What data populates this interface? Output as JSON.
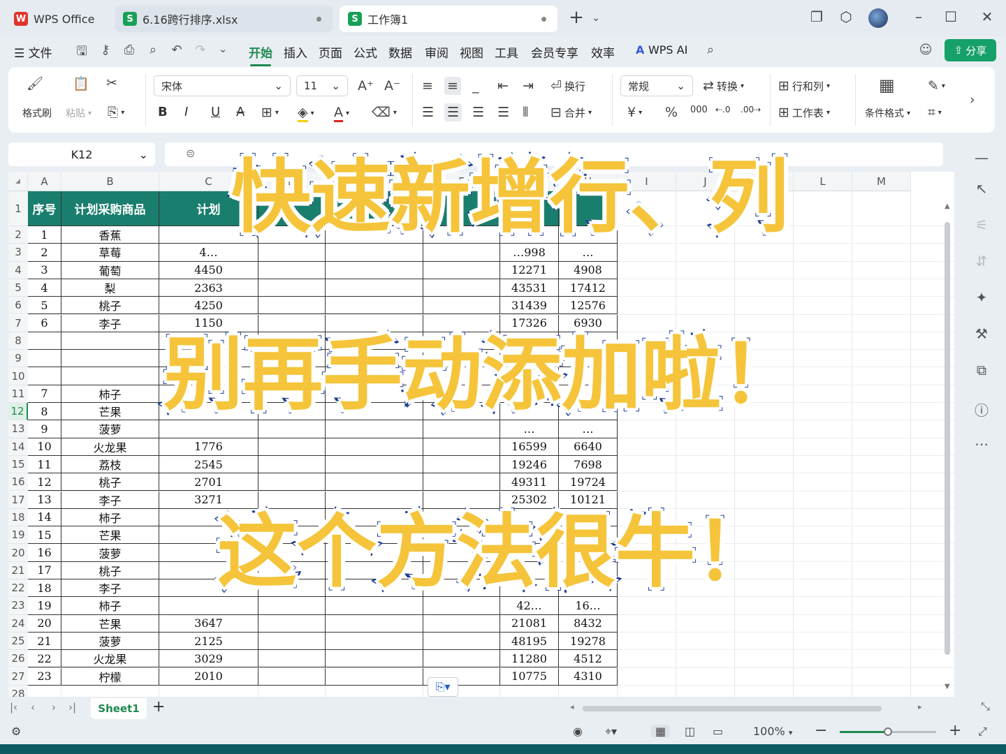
{
  "titlebar": {
    "tabs": [
      {
        "label": "WPS Office",
        "icon": "wps-logo-icon"
      },
      {
        "label": "6.16跨行排序.xlsx",
        "icon": "sheet-s-icon"
      },
      {
        "label": "工作簿1",
        "icon": "sheet-s-icon"
      }
    ],
    "new_tab": "+"
  },
  "menubar": {
    "file": "文件",
    "items": [
      "开始",
      "插入",
      "页面",
      "公式",
      "数据",
      "审阅",
      "视图",
      "工具",
      "会员专享",
      "效率"
    ],
    "wps_ai": "WPS AI",
    "share": "分享"
  },
  "ribbon": {
    "format_painter": "格式刷",
    "paste": "粘贴",
    "font_name": "宋体",
    "font_size": "11",
    "wrap": "换行",
    "merge": "合并",
    "number_format": "常规",
    "convert": "转换",
    "rows_cols": "行和列",
    "worksheet": "工作表",
    "cond_format": "条件格式",
    "bold": "B",
    "italic": "I",
    "underline": "U",
    "strike": "A",
    "currency": "¥",
    "percent": "%"
  },
  "formula": {
    "namebox": "K12"
  },
  "sheet": {
    "columns": [
      "A",
      "B",
      "C",
      "D",
      "E",
      "F",
      "G",
      "H",
      "I",
      "J",
      "K",
      "L",
      "M"
    ],
    "header": [
      "序号",
      "计划采购商品",
      "计划"
    ],
    "rows": [
      {
        "r": "1"
      },
      {
        "r": "2",
        "a": "1",
        "b": "香蕉",
        "c": "",
        "g": "",
        "h": ""
      },
      {
        "r": "3",
        "a": "2",
        "b": "草莓",
        "c": "4…",
        "g": "…998",
        "h": "…"
      },
      {
        "r": "4",
        "a": "3",
        "b": "葡萄",
        "c": "4450",
        "g": "12271",
        "h": "4908"
      },
      {
        "r": "5",
        "a": "4",
        "b": "梨",
        "c": "2363",
        "g": "43531",
        "h": "17412"
      },
      {
        "r": "6",
        "a": "5",
        "b": "桃子",
        "c": "4250",
        "g": "31439",
        "h": "12576"
      },
      {
        "r": "7",
        "a": "6",
        "b": "李子",
        "c": "1150",
        "g": "17326",
        "h": "6930"
      },
      {
        "r": "8",
        "a": "",
        "b": "",
        "c": "",
        "g": "",
        "h": ""
      },
      {
        "r": "9",
        "a": "",
        "b": "",
        "c": "",
        "g": "",
        "h": ""
      },
      {
        "r": "10",
        "a": "",
        "b": "",
        "c": "",
        "g": "",
        "h": ""
      },
      {
        "r": "11",
        "a": "7",
        "b": "柿子",
        "c": "",
        "g": "",
        "h": ""
      },
      {
        "r": "12",
        "a": "8",
        "b": "芒果",
        "c": "",
        "g": "",
        "h": ""
      },
      {
        "r": "13",
        "a": "9",
        "b": "菠萝",
        "c": "",
        "g": "…",
        "h": "…"
      },
      {
        "r": "14",
        "a": "10",
        "b": "火龙果",
        "c": "1776",
        "g": "16599",
        "h": "6640"
      },
      {
        "r": "15",
        "a": "11",
        "b": "荔枝",
        "c": "2545",
        "g": "19246",
        "h": "7698"
      },
      {
        "r": "16",
        "a": "12",
        "b": "桃子",
        "c": "2701",
        "g": "49311",
        "h": "19724"
      },
      {
        "r": "17",
        "a": "13",
        "b": "李子",
        "c": "3271",
        "g": "25302",
        "h": "10121"
      },
      {
        "r": "18",
        "a": "14",
        "b": "柿子",
        "c": "",
        "g": "",
        "h": ""
      },
      {
        "r": "19",
        "a": "15",
        "b": "芒果",
        "c": "",
        "g": "",
        "h": ""
      },
      {
        "r": "20",
        "a": "16",
        "b": "菠萝",
        "c": "",
        "g": "",
        "h": ""
      },
      {
        "r": "21",
        "a": "17",
        "b": "桃子",
        "c": "",
        "g": "",
        "h": ""
      },
      {
        "r": "22",
        "a": "18",
        "b": "李子",
        "c": "",
        "g": "",
        "h": ""
      },
      {
        "r": "23",
        "a": "19",
        "b": "柿子",
        "c": "",
        "g": "42…",
        "h": "16…"
      },
      {
        "r": "24",
        "a": "20",
        "b": "芒果",
        "c": "3647",
        "g": "21081",
        "h": "8432"
      },
      {
        "r": "25",
        "a": "21",
        "b": "菠萝",
        "c": "2125",
        "g": "48195",
        "h": "19278"
      },
      {
        "r": "26",
        "a": "22",
        "b": "火龙果",
        "c": "3029",
        "g": "11280",
        "h": "4512"
      },
      {
        "r": "27",
        "a": "23",
        "b": "柠檬",
        "c": "2010",
        "g": "10775",
        "h": "4310"
      },
      {
        "r": "28"
      }
    ],
    "selected_row": "12"
  },
  "sheet_tabs": {
    "active": "Sheet1",
    "add": "+"
  },
  "status": {
    "zoom": "100%",
    "zoom_fraction": 0.5
  },
  "overlay": {
    "line1": "快速新增行、列",
    "line2": "别再手动添加啦！",
    "line3": "这个方法很牛！"
  },
  "colors": {
    "accent": "#1e8a4f",
    "header_fill": "#1a7e6e",
    "headline_fill": "#f5c43a",
    "headline_stroke": "#1d3d8f"
  }
}
